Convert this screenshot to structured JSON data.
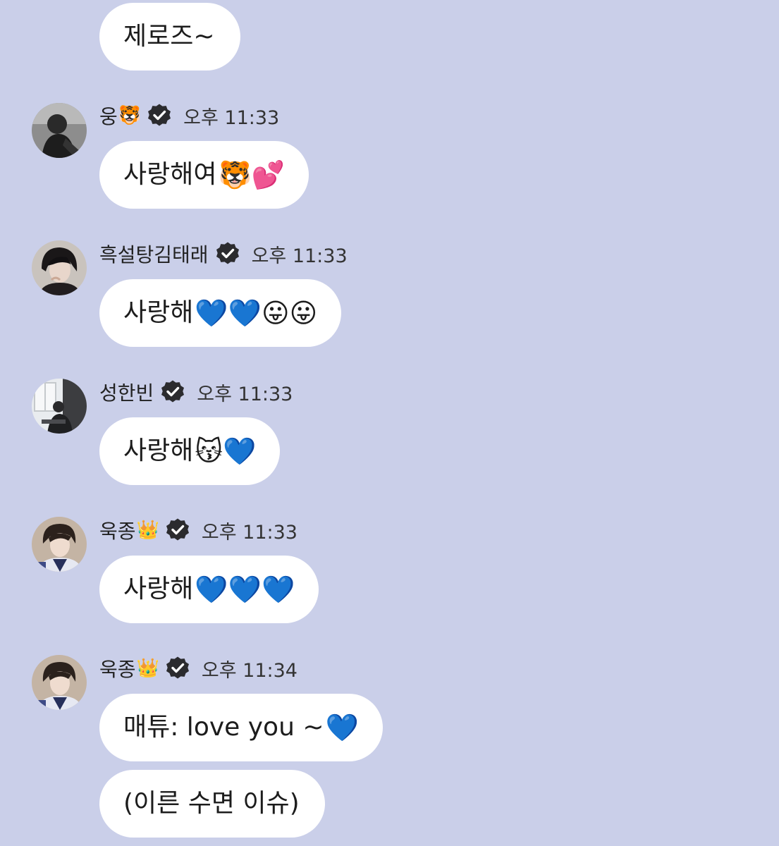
{
  "messages": [
    {
      "type": "bubble",
      "text": "제로즈~",
      "emoji": ""
    },
    {
      "type": "post",
      "user": {
        "name": "웅",
        "name_emoji": "🐯",
        "verified": true,
        "avatar": "avatar-dark-portrait"
      },
      "time": "오후 11:33",
      "bubbles": [
        {
          "text": "사랑해여 ",
          "emoji": "🐯💕"
        }
      ]
    },
    {
      "type": "post",
      "user": {
        "name": "흑설탕김태래",
        "name_emoji": "",
        "verified": true,
        "avatar": "avatar-dark-hair-portrait"
      },
      "time": "오후 11:33",
      "bubbles": [
        {
          "text": "사랑해",
          "emoji": "💙💙😛😛"
        }
      ]
    },
    {
      "type": "post",
      "user": {
        "name": "성한빈",
        "name_emoji": "",
        "verified": true,
        "avatar": "avatar-window-silhouette"
      },
      "time": "오후 11:33",
      "bubbles": [
        {
          "text": "사랑해",
          "emoji": "😽💙"
        }
      ]
    },
    {
      "type": "post",
      "user": {
        "name": "욱종",
        "name_emoji": "👑",
        "verified": true,
        "avatar": "avatar-suit-portrait"
      },
      "time": "오후 11:33",
      "bubbles": [
        {
          "text": "사랑해",
          "emoji": "💙💙💙"
        }
      ]
    },
    {
      "type": "post",
      "user": {
        "name": "욱종",
        "name_emoji": "👑",
        "verified": true,
        "avatar": "avatar-suit-portrait"
      },
      "time": "오후 11:34",
      "bubbles": [
        {
          "text": "매튜: love you ~",
          "emoji": "💙"
        },
        {
          "text": "(이른 수면 이슈)",
          "emoji": ""
        }
      ]
    }
  ],
  "colors": {
    "background": "#cacfe9",
    "bubble": "#ffffff",
    "verified_badge": "#2b2b2e"
  }
}
